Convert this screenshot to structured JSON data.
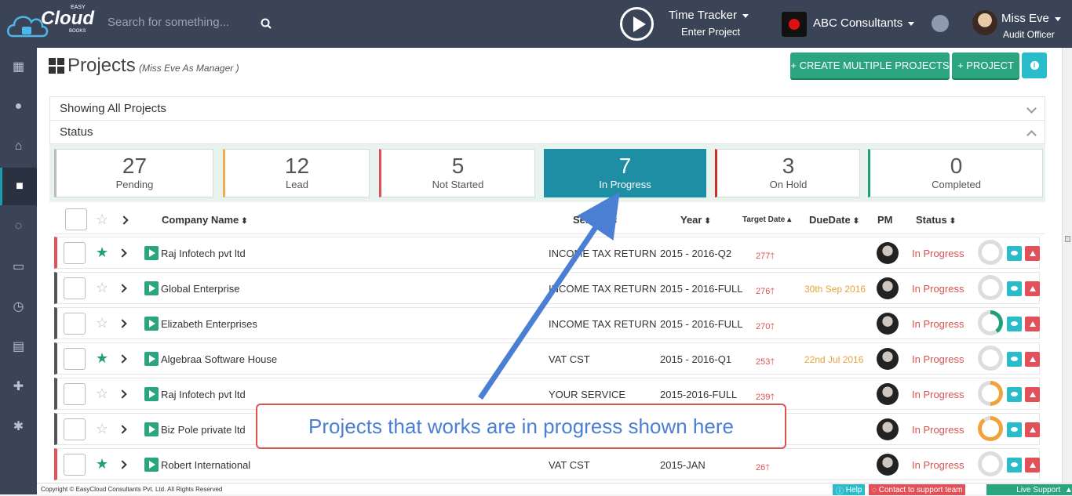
{
  "header": {
    "brand": "Cloud",
    "brand_super": "EASY",
    "brand_sub": "BOOKS",
    "search_placeholder": "Search for something...",
    "timer_title": "Time Tracker",
    "timer_sub": "Enter Project",
    "company": "ABC Consultants",
    "user_name": "Miss Eve",
    "user_role": "Audit Officer"
  },
  "sidebar": {
    "items": [
      "dashboard-icon",
      "user-icon",
      "bank-icon",
      "briefcase-icon",
      "chat-icon",
      "document-icon",
      "clock-icon",
      "newspaper-icon",
      "plus-icon",
      "gear-icon"
    ],
    "active_index": 3
  },
  "page": {
    "title": "Projects",
    "subtitle": "(Miss Eve As Manager )",
    "create_multiple_label": "+ CREATE MULTIPLE PROJECTS",
    "project_label": "+ PROJECT",
    "info_label": "i"
  },
  "panels": {
    "showing": "Showing All Projects",
    "status": "Status"
  },
  "status_cards": [
    {
      "count": "27",
      "label": "Pending",
      "color": "#bbbbbb"
    },
    {
      "count": "12",
      "label": "Lead",
      "color": "#f0ad4e"
    },
    {
      "count": "5",
      "label": "Not Started",
      "color": "#e2505a"
    },
    {
      "count": "7",
      "label": "In Progress",
      "color": "#1e8ea5"
    },
    {
      "count": "3",
      "label": "On Hold",
      "color": "#c9302c"
    },
    {
      "count": "0",
      "label": "Completed",
      "color": "#1ea17b"
    }
  ],
  "table": {
    "columns": [
      "Company Name",
      "Service",
      "Year",
      "Target Date",
      "DueDate",
      "PM",
      "Status"
    ],
    "rows": [
      {
        "starred": true,
        "company": "Raj Infotech pvt ltd",
        "service": "INCOME TAX RETURN",
        "year": "2015 - 2016-Q2",
        "target": "277",
        "due": "",
        "status": "In Progress",
        "accent": "red",
        "progress": 0
      },
      {
        "starred": false,
        "company": "Global Enterprise",
        "service": "INCOME TAX RETURN",
        "year": "2015 - 2016-FULL",
        "target": "276",
        "due": "30th Sep 2016",
        "status": "In Progress",
        "accent": "dark",
        "progress": 0
      },
      {
        "starred": false,
        "company": "Elizabeth Enterprises",
        "service": "INCOME TAX RETURN",
        "year": "2015 - 2016-FULL",
        "target": "270",
        "due": "",
        "status": "In Progress",
        "accent": "dark",
        "progress": 0.4
      },
      {
        "starred": true,
        "company": "Algebraa Software House",
        "service": "VAT CST",
        "year": "2015 - 2016-Q1",
        "target": "253",
        "due": "22nd Jul 2016",
        "status": "In Progress",
        "accent": "dark",
        "progress": 0
      },
      {
        "starred": false,
        "company": "Raj Infotech pvt ltd",
        "service": "YOUR SERVICE",
        "year": "2015-2016-FULL",
        "target": "239",
        "due": "",
        "status": "In Progress",
        "accent": "dark",
        "progress": 0.5
      },
      {
        "starred": false,
        "company": "Biz Pole private ltd",
        "service": "",
        "year": "",
        "target": "",
        "due": "",
        "status": "In Progress",
        "accent": "dark",
        "progress": 0.9
      },
      {
        "starred": true,
        "company": "Robert International",
        "service": "VAT CST",
        "year": "2015-JAN",
        "target": "26",
        "due": "",
        "status": "In Progress",
        "accent": "red",
        "progress": 0
      }
    ]
  },
  "callout": "Projects that works are in progress shown here",
  "footer": {
    "copyright": "Copyright © EasyCloud Consultants Pvt. Ltd. All Rights Reserved",
    "help": "Help",
    "contact": "Contact to support team",
    "live": "Live Support"
  }
}
